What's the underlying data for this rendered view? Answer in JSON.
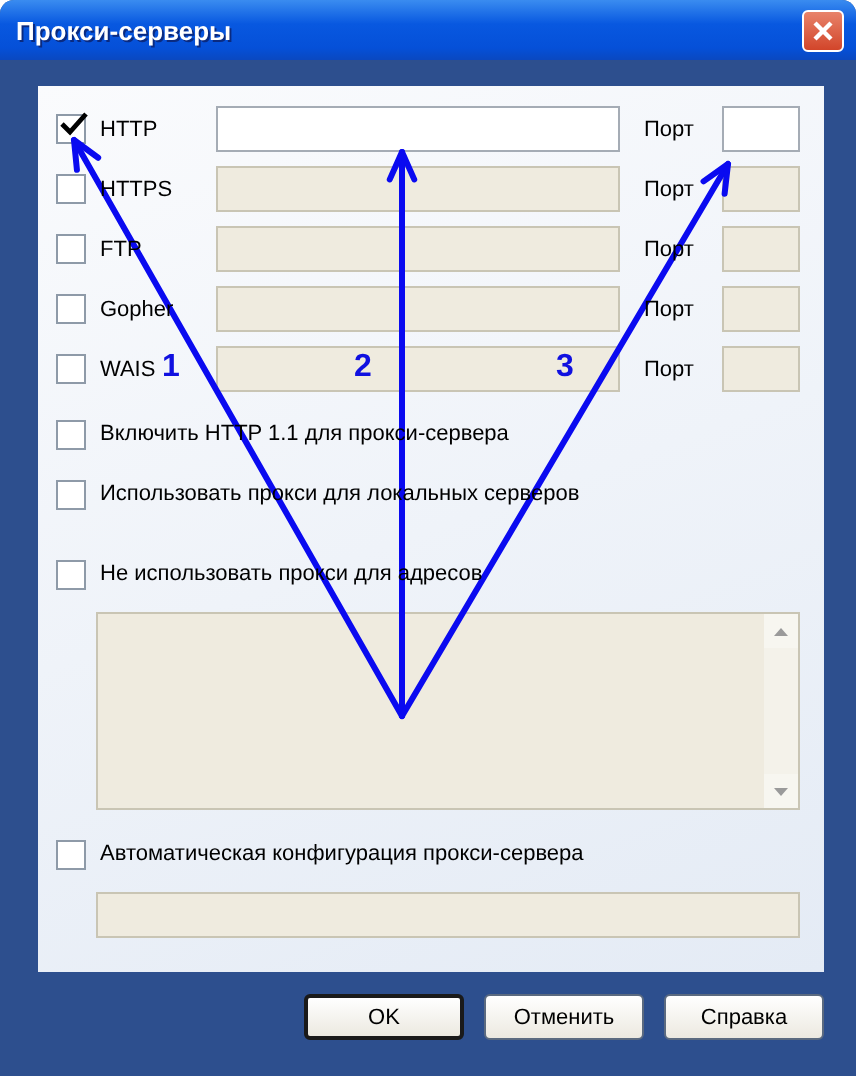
{
  "window": {
    "title": "Прокси-серверы"
  },
  "proxies": [
    {
      "name": "HTTP",
      "checked": true,
      "enabled": true,
      "port_label": "Порт"
    },
    {
      "name": "HTTPS",
      "checked": false,
      "enabled": false,
      "port_label": "Порт"
    },
    {
      "name": "FTP",
      "checked": false,
      "enabled": false,
      "port_label": "Порт"
    },
    {
      "name": "Gopher",
      "checked": false,
      "enabled": false,
      "port_label": "Порт"
    },
    {
      "name": "WAIS",
      "checked": false,
      "enabled": false,
      "port_label": "Порт"
    }
  ],
  "options": [
    {
      "label": "Включить HTTP 1.1 для прокси-сервера",
      "checked": false
    },
    {
      "label": "Использовать прокси для локальных серверов",
      "checked": false
    }
  ],
  "bypass": {
    "label": "Не использовать прокси для адресов",
    "checked": false
  },
  "auto_config": {
    "label": "Автоматическая конфигурация прокси-сервера",
    "checked": false
  },
  "buttons": [
    {
      "label": "OK",
      "default": true
    },
    {
      "label": "Отменить",
      "default": false
    },
    {
      "label": "Справка",
      "default": false
    }
  ],
  "annotations": [
    {
      "number": "1"
    },
    {
      "number": "2"
    },
    {
      "number": "3"
    }
  ]
}
